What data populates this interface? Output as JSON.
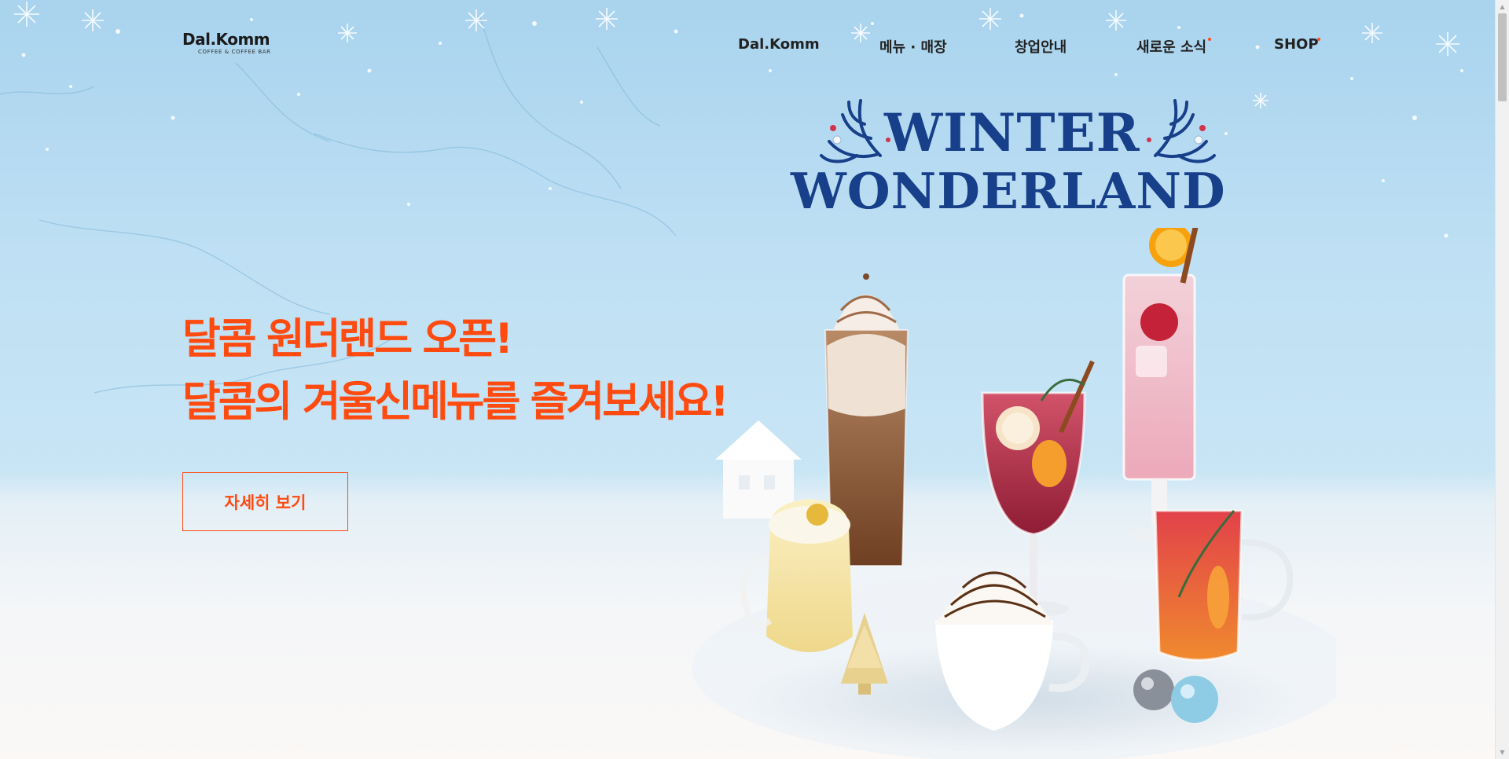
{
  "brand": {
    "logo_text": "Dal.Komm",
    "logo_subtext": "COFFEE & COFFEE BAR"
  },
  "nav": {
    "items": [
      {
        "label": "Dal.Komm",
        "has_dot": false
      },
      {
        "label": "메뉴 · 매장",
        "has_dot": false
      },
      {
        "label": "창업안내",
        "has_dot": false
      },
      {
        "label": "새로운 소식",
        "has_dot": true
      },
      {
        "label": "SHOP",
        "has_dot": true
      }
    ]
  },
  "hero": {
    "headline_line1": "달콤 원더랜드 오픈!",
    "headline_line2": "달콤의 겨울신메뉴를 즐겨보세요!",
    "cta_label": "자세히 보기",
    "promo_title_line1": "WINTER",
    "promo_title_line2": "WONDERLAND"
  },
  "colors": {
    "accent": "#ff4a10",
    "nav_text": "#222222",
    "promo_title": "#173f8a",
    "sky_top": "#a9d3ee",
    "floor": "#fbf8f6"
  },
  "icons": {
    "scroll_up": "triangle-up-icon",
    "scroll_down": "triangle-down-icon"
  }
}
